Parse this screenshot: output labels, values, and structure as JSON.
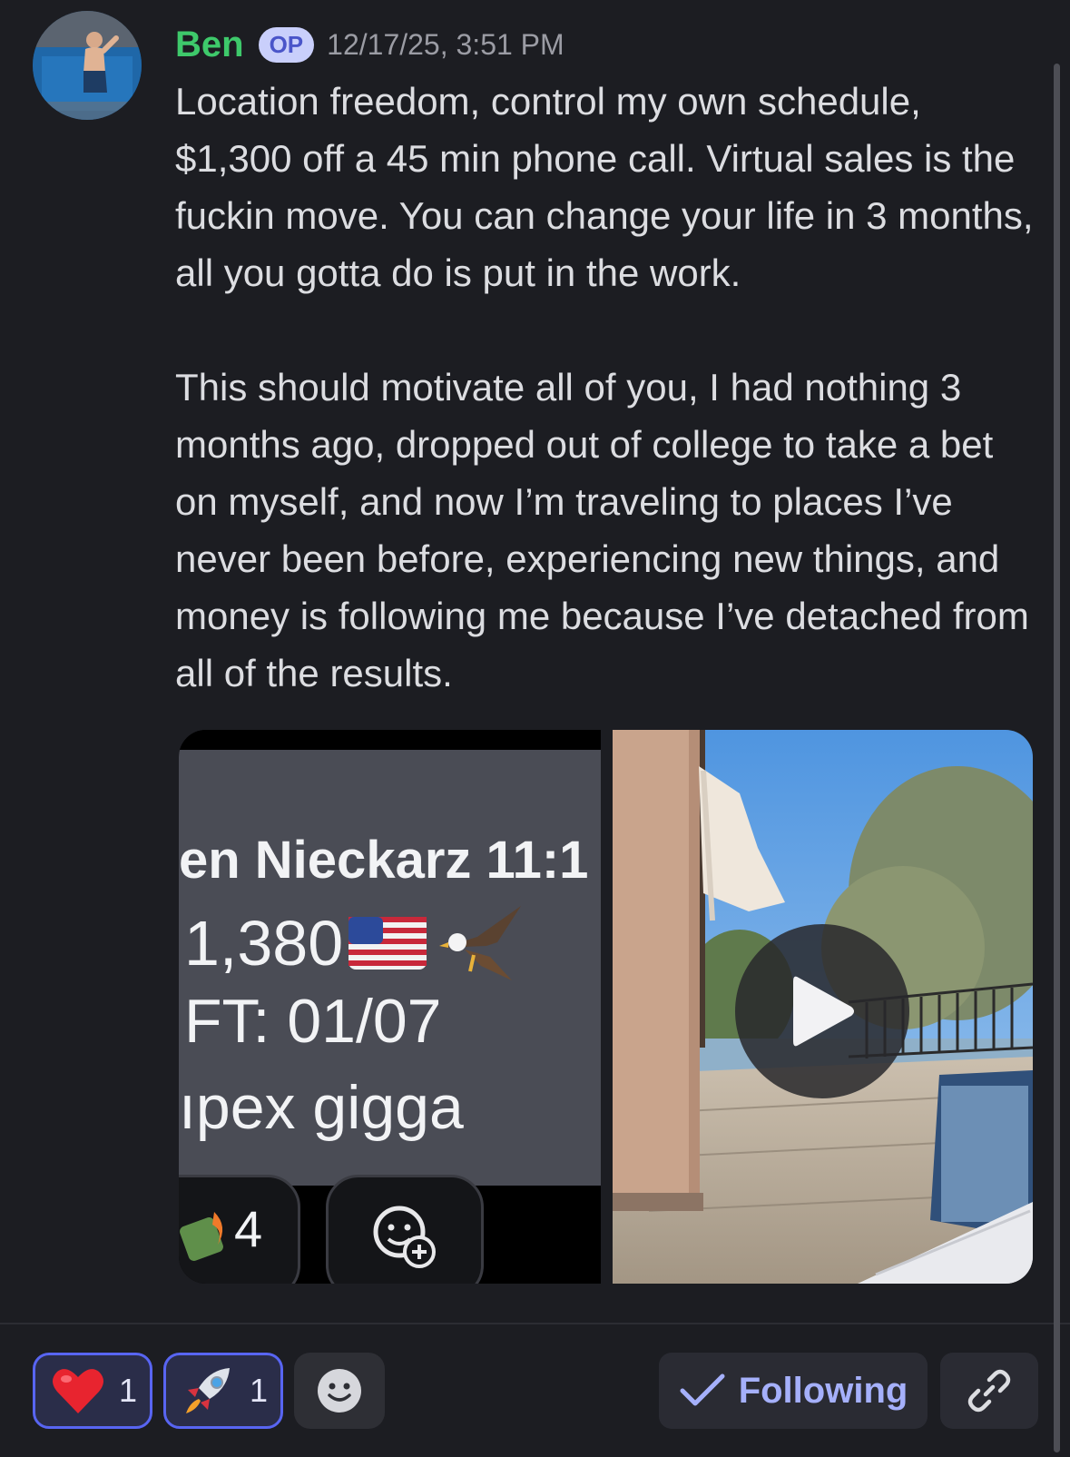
{
  "post": {
    "author": "Ben",
    "badge": "OP",
    "timestamp": "12/17/25, 3:51 PM",
    "paragraph1": "Location freedom, control my own schedule, $1,300 off a 45 min phone call. Virtual sales is the fuckin move. You can change your life in 3 months, all you gotta do is put in the work.",
    "paragraph2": "This should motivate all of you, I had nothing 3 months ago, dropped out of college to take a bet on myself, and now I’m traveling to places I’ve never been before, experiencing new things, and money is following me because I’ve detached from all of the results."
  },
  "attachments": {
    "screenshot": {
      "name_line": "en Nieckarz 11:1",
      "amount_line": "1,380",
      "ft_line": "FT: 01/07",
      "apex_line": "ıpex gigga",
      "reaction_count": "4"
    },
    "video": {
      "play_icon": "play-icon"
    }
  },
  "reactions": [
    {
      "emoji": "heart",
      "count": "1"
    },
    {
      "emoji": "rocket",
      "count": "1"
    }
  ],
  "actions": {
    "following_label": "Following",
    "link_icon": "link-icon"
  },
  "colors": {
    "background": "#1c1d22",
    "username": "#3ec96b",
    "accent": "#5865f2",
    "following": "#a5b0fb"
  }
}
